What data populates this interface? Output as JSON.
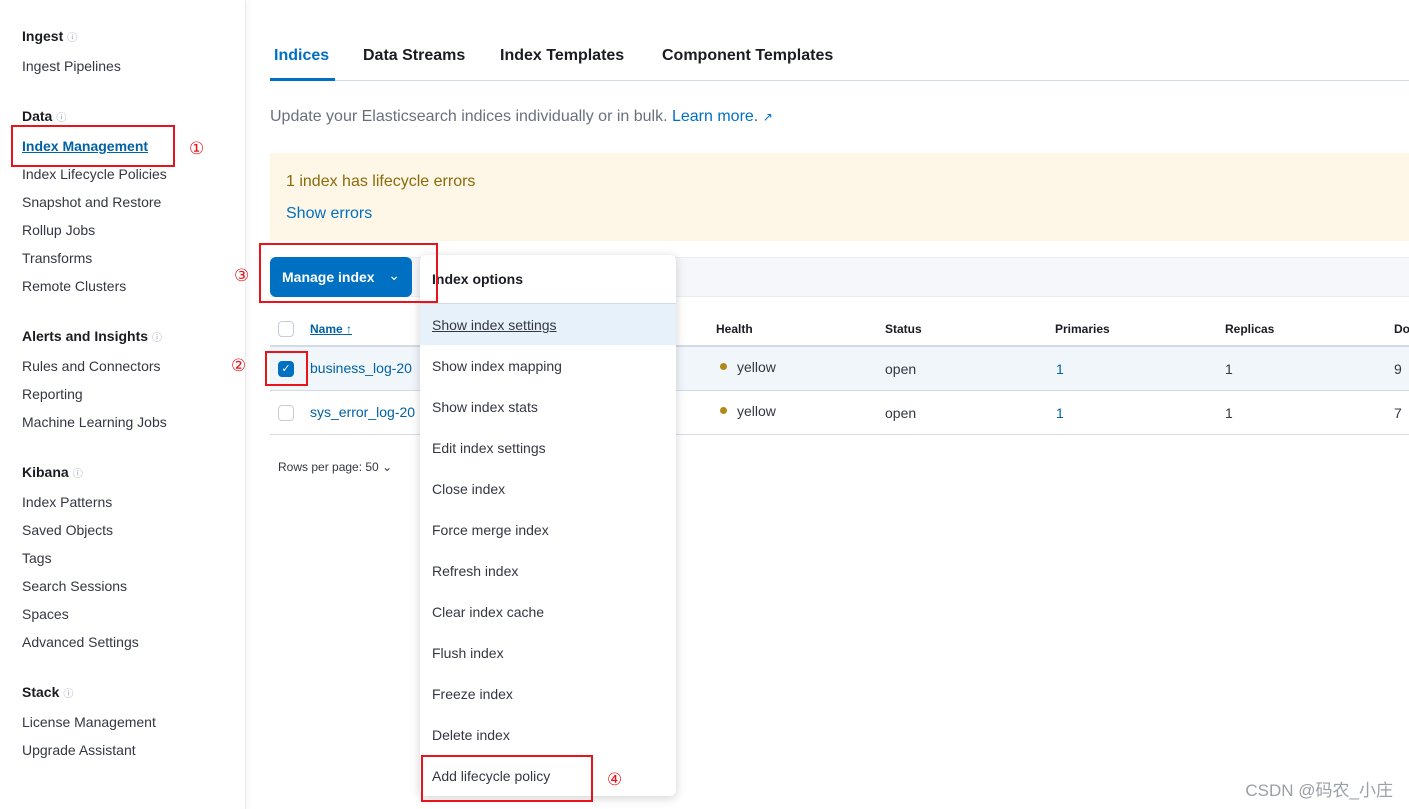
{
  "sidebar": {
    "sections": [
      {
        "title": "Ingest",
        "items": [
          "Ingest Pipelines"
        ]
      },
      {
        "title": "Data",
        "items": [
          "Index Management",
          "Index Lifecycle Policies",
          "Snapshot and Restore",
          "Rollup Jobs",
          "Transforms",
          "Remote Clusters"
        ]
      },
      {
        "title": "Alerts and Insights",
        "items": [
          "Rules and Connectors",
          "Reporting",
          "Machine Learning Jobs"
        ]
      },
      {
        "title": "Kibana",
        "items": [
          "Index Patterns",
          "Saved Objects",
          "Tags",
          "Search Sessions",
          "Spaces",
          "Advanced Settings"
        ]
      },
      {
        "title": "Stack",
        "items": [
          "License Management",
          "Upgrade Assistant"
        ]
      }
    ],
    "active": "Index Management",
    "help_icon": "question-circle-icon"
  },
  "tabs": [
    "Indices",
    "Data Streams",
    "Index Templates",
    "Component Templates"
  ],
  "description": "Update your Elasticsearch indices individually or in bulk.",
  "learn_more": "Learn more.",
  "callout": {
    "title": "1 index has lifecycle errors",
    "action": "Show errors"
  },
  "manage_button": "Manage index",
  "table": {
    "columns": [
      "Name",
      "Health",
      "Status",
      "Primaries",
      "Replicas",
      "Do"
    ],
    "rows": [
      {
        "name": "business_log-20",
        "health": "yellow",
        "status": "open",
        "primaries": "1",
        "replicas": "1",
        "docs": "9",
        "checked": true
      },
      {
        "name": "sys_error_log-20",
        "health": "yellow",
        "status": "open",
        "primaries": "1",
        "replicas": "1",
        "docs": "7",
        "checked": false
      }
    ]
  },
  "rows_per_page": "Rows per page: 50",
  "menu": {
    "title": "Index options",
    "items": [
      "Show index settings",
      "Show index mapping",
      "Show index stats",
      "Edit index settings",
      "Close index",
      "Force merge index",
      "Refresh index",
      "Clear index cache",
      "Flush index",
      "Freeze index",
      "Delete index",
      "Add lifecycle policy"
    ]
  },
  "annotations": [
    "①",
    "②",
    "③",
    "④"
  ],
  "watermark": "CSDN @码农_小庄",
  "colors": {
    "primary": "#0071c2",
    "annotation": "#e8141b",
    "warning_bg": "#fef6e6"
  }
}
